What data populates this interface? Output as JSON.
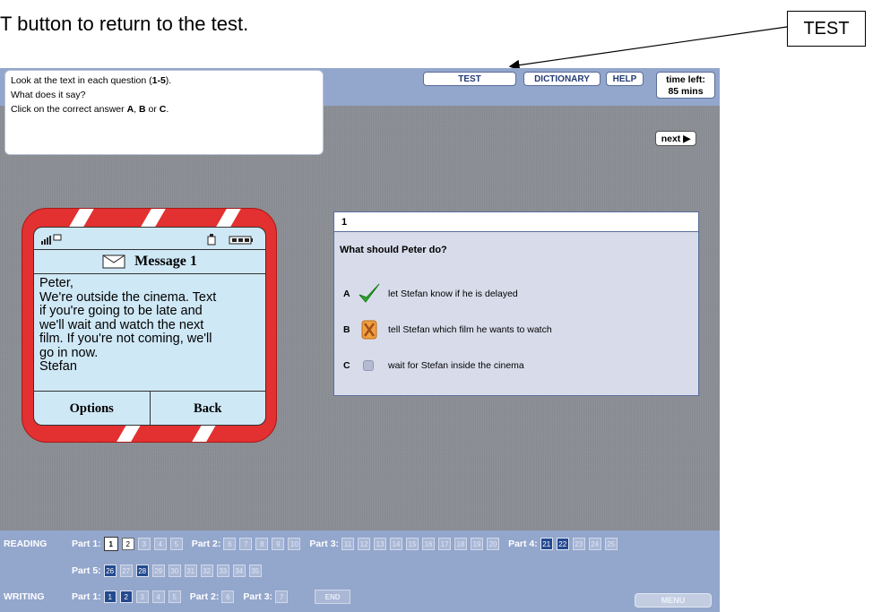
{
  "caption": "T button to return to the test.",
  "callout_label": "TEST",
  "instructions": {
    "line1_pre": "Look at the text in each question (",
    "line1_bold": "1-5",
    "line1_post": ").",
    "line2": "What does it say?",
    "line3_pre": "Click on the correct answer ",
    "a": "A",
    "sep1": ", ",
    "b": "B",
    "sep2": " or ",
    "c": "C",
    "end": "."
  },
  "topbar": {
    "test": "TEST",
    "dictionary": "DICTIONARY",
    "help": "HELP",
    "time_label": "time left:",
    "time_value": "85 mins"
  },
  "next_label": "next ▶",
  "phone": {
    "title": "Message 1",
    "message": [
      "Peter,",
      "We're outside the cinema. Text",
      "if you're going to be late and",
      "we'll wait and watch the next",
      "film. If you're not coming, we'll",
      "go in now.",
      "Stefan"
    ],
    "options": "Options",
    "back": "Back"
  },
  "question": {
    "number": "1",
    "text": "What should Peter do?",
    "options": [
      {
        "letter": "A",
        "text": "let Stefan know if he is delayed",
        "state": "correct"
      },
      {
        "letter": "B",
        "text": "tell Stefan which film he wants to watch",
        "state": "wrong"
      },
      {
        "letter": "C",
        "text": "wait for Stefan inside the cinema",
        "state": "none"
      }
    ]
  },
  "nav": {
    "reading": "READING",
    "writing": "WRITING",
    "reading_parts_row1": [
      {
        "label": "Part 1:",
        "items": [
          {
            "n": "1",
            "s": "cur"
          },
          {
            "n": "2",
            "s": "seen"
          },
          {
            "n": "3",
            "s": "plain"
          },
          {
            "n": "4",
            "s": "plain"
          },
          {
            "n": "5",
            "s": "plain"
          }
        ]
      },
      {
        "label": "Part 2:",
        "items": [
          {
            "n": "6",
            "s": "plain"
          },
          {
            "n": "7",
            "s": "plain"
          },
          {
            "n": "8",
            "s": "plain"
          },
          {
            "n": "9",
            "s": "plain"
          },
          {
            "n": "10",
            "s": "plain"
          }
        ]
      },
      {
        "label": "Part 3:",
        "items": [
          {
            "n": "11",
            "s": "plain"
          },
          {
            "n": "12",
            "s": "plain"
          },
          {
            "n": "13",
            "s": "plain"
          },
          {
            "n": "14",
            "s": "plain"
          },
          {
            "n": "15",
            "s": "plain"
          },
          {
            "n": "16",
            "s": "plain"
          },
          {
            "n": "17",
            "s": "plain"
          },
          {
            "n": "18",
            "s": "plain"
          },
          {
            "n": "19",
            "s": "plain"
          },
          {
            "n": "20",
            "s": "plain"
          }
        ]
      },
      {
        "label": "Part 4:",
        "items": [
          {
            "n": "21",
            "s": "done"
          },
          {
            "n": "22",
            "s": "done"
          },
          {
            "n": "23",
            "s": "plain"
          },
          {
            "n": "24",
            "s": "plain"
          },
          {
            "n": "25",
            "s": "plain"
          }
        ]
      }
    ],
    "reading_parts_row2": [
      {
        "label": "Part 5:",
        "items": [
          {
            "n": "26",
            "s": "done"
          },
          {
            "n": "27",
            "s": "plain"
          },
          {
            "n": "28",
            "s": "done"
          },
          {
            "n": "29",
            "s": "plain"
          },
          {
            "n": "30",
            "s": "plain"
          },
          {
            "n": "31",
            "s": "plain"
          },
          {
            "n": "32",
            "s": "plain"
          },
          {
            "n": "33",
            "s": "plain"
          },
          {
            "n": "34",
            "s": "plain"
          },
          {
            "n": "35",
            "s": "plain"
          }
        ]
      }
    ],
    "writing_parts": [
      {
        "label": "Part 1:",
        "items": [
          {
            "n": "1",
            "s": "done"
          },
          {
            "n": "2",
            "s": "done"
          },
          {
            "n": "3",
            "s": "plain"
          },
          {
            "n": "4",
            "s": "plain"
          },
          {
            "n": "5",
            "s": "plain"
          }
        ]
      },
      {
        "label": "Part 2:",
        "items": [
          {
            "n": "6",
            "s": "plain"
          }
        ]
      },
      {
        "label": "Part 3:",
        "items": [
          {
            "n": "7",
            "s": "plain"
          }
        ]
      }
    ],
    "end": "END",
    "menu": "MENU"
  }
}
